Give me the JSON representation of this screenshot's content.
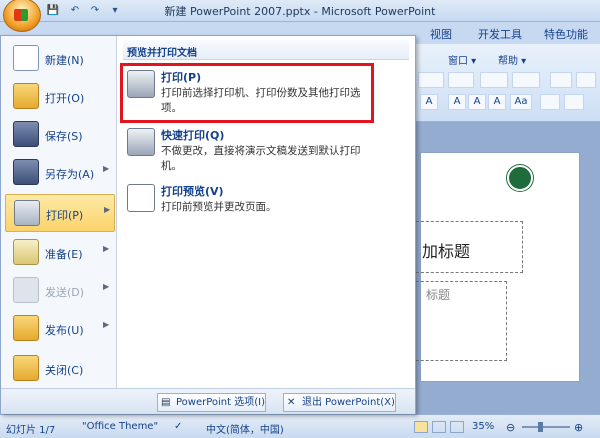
{
  "window": {
    "title": "新建 PowerPoint 2007.pptx - Microsoft PowerPoint"
  },
  "qat": {
    "save": "💾",
    "undo": "↶",
    "redo": "↷",
    "customize": "▾"
  },
  "ribbon_tabs": [
    "视图",
    "开发工具",
    "特色功能"
  ],
  "ribbon_row": [
    "窗口 ▾",
    "帮助 ▾"
  ],
  "ribbon_buttons": [
    "A",
    "A",
    "A",
    "A",
    "Aa"
  ],
  "slide": {
    "title": "加标题",
    "subtitle": "标题"
  },
  "menu": {
    "left_items": [
      {
        "label": "新建(N)",
        "icon": "new-document-icon"
      },
      {
        "label": "打开(O)",
        "icon": "open-folder-icon"
      },
      {
        "label": "保存(S)",
        "icon": "save-icon"
      },
      {
        "label": "另存为(A)",
        "icon": "save-as-icon",
        "arrow": "▶"
      },
      {
        "label": "打印(P)",
        "icon": "printer-icon",
        "arrow": "▶"
      },
      {
        "label": "准备(E)",
        "icon": "prepare-icon",
        "arrow": "▶"
      },
      {
        "label": "发送(D)",
        "icon": "send-icon",
        "arrow": "▶"
      },
      {
        "label": "发布(U)",
        "icon": "publish-icon",
        "arrow": "▶"
      },
      {
        "label": "关闭(C)",
        "icon": "close-folder-icon"
      }
    ],
    "right_header": "预览并打印文档",
    "right_entries": [
      {
        "title": "打印(P)",
        "desc": "打印前选择打印机、打印份数及其他打印选项。"
      },
      {
        "title": "快速打印(Q)",
        "desc": "不做更改，直接将演示文稿发送到默认打印机。"
      },
      {
        "title": "打印预览(V)",
        "desc": "打印前预览并更改页面。"
      }
    ],
    "options_button": "PowerPoint 选项(I)",
    "exit_button": "退出 PowerPoint(X)"
  },
  "status": {
    "slide": "幻灯片 1/7",
    "theme": "\"Office Theme\"",
    "lang": "中文(简体，中国)",
    "zoom": "35%"
  }
}
